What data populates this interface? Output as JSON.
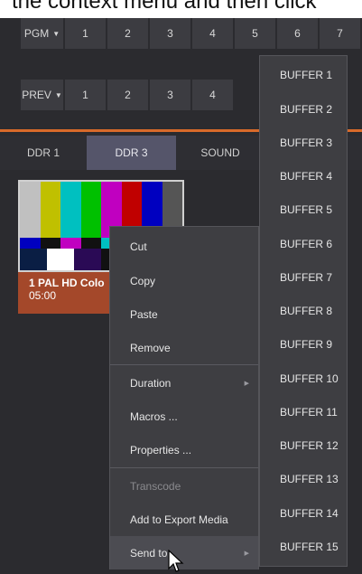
{
  "header_text": "the context menu and then click",
  "pgm": {
    "label": "PGM",
    "buttons": [
      "1",
      "2",
      "3",
      "4",
      "5",
      "6",
      "7"
    ]
  },
  "prev": {
    "label": "PREV",
    "buttons": [
      "1",
      "2",
      "3",
      "4"
    ]
  },
  "tabs": [
    "DDR 1",
    "DDR 3",
    "SOUND"
  ],
  "media": {
    "title": "1 PAL HD Colo",
    "duration": "05:00"
  },
  "context_menu": [
    "Cut",
    "Copy",
    "Paste",
    "Remove",
    "Duration",
    "Macros ...",
    "Properties ...",
    "Transcode",
    "Add to Export Media",
    "Send to"
  ],
  "buffers": [
    "BUFFER 1",
    "BUFFER 2",
    "BUFFER 3",
    "BUFFER 4",
    "BUFFER 5",
    "BUFFER 6",
    "BUFFER 7",
    "BUFFER 8",
    "BUFFER 9",
    "BUFFER 10",
    "BUFFER 11",
    "BUFFER 12",
    "BUFFER 13",
    "BUFFER 14",
    "BUFFER 15"
  ],
  "colors": {
    "accent": "#d86a2a",
    "media_caption": "#a4482a",
    "active_tab": "#55556a"
  },
  "icons": {
    "dropdown": "caret-down-icon",
    "submenu": "submenu-arrow-icon",
    "cursor": "mouse-pointer-icon"
  }
}
